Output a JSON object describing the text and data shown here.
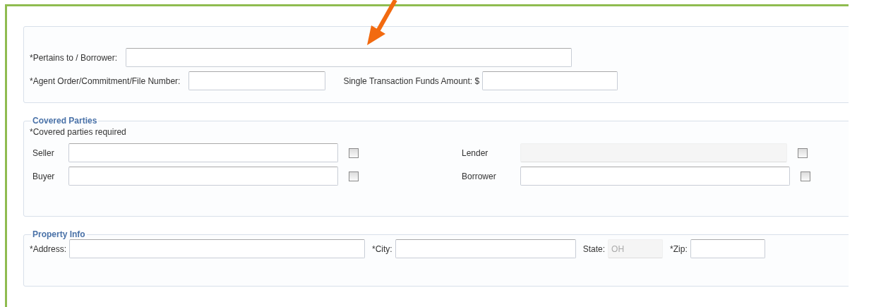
{
  "sections": [
    {
      "rows": [
        [
          {
            "kind": "label",
            "text": "*Pertains to / Borrower:"
          },
          {
            "kind": "field",
            "disabled": false
          }
        ],
        [
          {
            "kind": "label",
            "text": "*Agent Order/Commitment/File Number:"
          },
          {
            "kind": "field",
            "disabled": false
          },
          {
            "kind": "label",
            "text": "Single Transaction Funds Amount: $"
          },
          {
            "kind": "field",
            "disabled": false
          }
        ]
      ]
    },
    {
      "legend": "Covered Parties",
      "note": "*Covered parties required",
      "rows": [
        [
          {
            "kind": "label",
            "text": "Seller"
          },
          {
            "kind": "field",
            "disabled": false
          },
          {
            "kind": "checkbox",
            "checked": false
          },
          {
            "kind": "label",
            "text": "Lender"
          },
          {
            "kind": "field",
            "disabled": true
          },
          {
            "kind": "checkbox",
            "checked": false
          }
        ],
        [
          {
            "kind": "label",
            "text": "Buyer"
          },
          {
            "kind": "field",
            "disabled": false
          },
          {
            "kind": "checkbox",
            "checked": false
          },
          {
            "kind": "label",
            "text": "Borrower"
          },
          {
            "kind": "field",
            "disabled": false
          },
          {
            "kind": "checkbox",
            "checked": false
          }
        ]
      ]
    },
    {
      "legend": "Property Info",
      "rows": [
        [
          {
            "kind": "label",
            "text": "*Address:"
          },
          {
            "kind": "field",
            "disabled": false
          },
          {
            "kind": "label",
            "text": "*City:"
          },
          {
            "kind": "field",
            "disabled": false
          },
          {
            "kind": "label",
            "text": "State:"
          },
          {
            "kind": "field",
            "disabled": true,
            "value": "OH"
          },
          {
            "kind": "label",
            "text": "*Zip:"
          },
          {
            "kind": "field",
            "disabled": false
          }
        ]
      ]
    }
  ]
}
